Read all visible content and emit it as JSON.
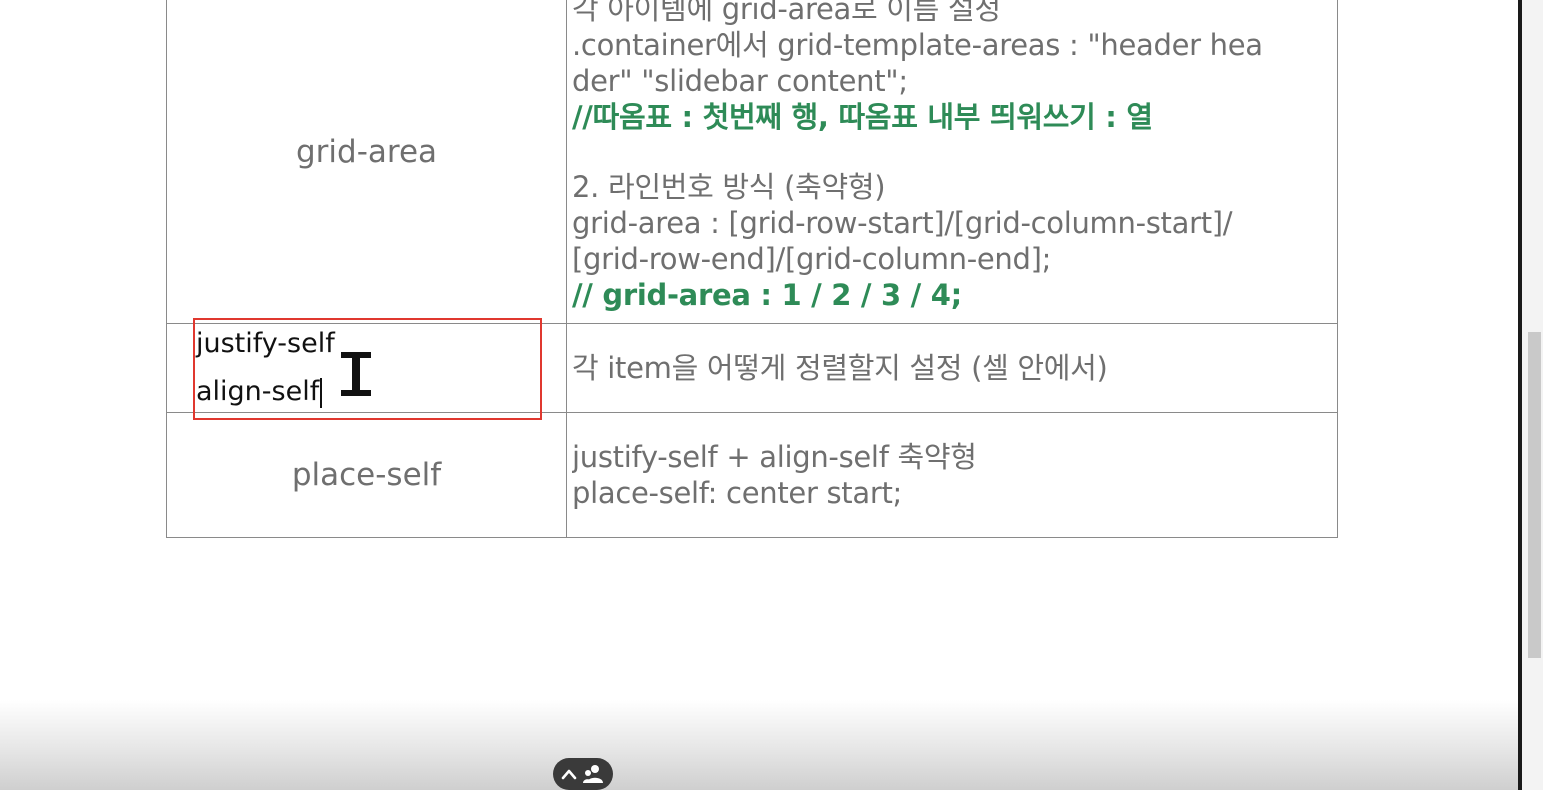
{
  "table": {
    "rows": [
      {
        "property": "grid-area",
        "lines": [
          {
            "text": "각 아이템에 grid-area로 이름 설정",
            "kind": "normal"
          },
          {
            "text": ".container에서 grid-template-areas : \"header hea",
            "kind": "normal"
          },
          {
            "text": "der\" \"slidebar content\";",
            "kind": "normal"
          },
          {
            "text": "//따옴표 : 첫번째 행, 따옴표 내부 띄워쓰기 : 열",
            "kind": "comment"
          },
          {
            "text": "",
            "kind": "spacer"
          },
          {
            "text": "2. 라인번호 방식 (축약형)",
            "kind": "normal"
          },
          {
            "text": "grid-area : [grid-row-start]/[grid-column-start]/",
            "kind": "normal"
          },
          {
            "text": "[grid-row-end]/[grid-column-end];",
            "kind": "normal"
          },
          {
            "text": "// grid-area : 1 / 2 / 3 / 4;",
            "kind": "comment"
          }
        ]
      },
      {
        "property_lines": [
          "justify-self",
          "align-self"
        ],
        "description": "각 item을 어떻게 정렬할지 설정 (셀 안에서)"
      },
      {
        "property": "place-self",
        "lines": [
          {
            "text": "justify-self + align-self 축약형",
            "kind": "normal"
          },
          {
            "text": "place-self: center start;",
            "kind": "normal"
          }
        ]
      }
    ]
  },
  "colors": {
    "text": "#6f6f6f",
    "comment": "#2e8b57",
    "edit_border": "#e0382f"
  },
  "icons": {
    "cursor": "ibeam-cursor-icon",
    "controls": [
      "chevron-up-icon",
      "people-icon"
    ]
  }
}
